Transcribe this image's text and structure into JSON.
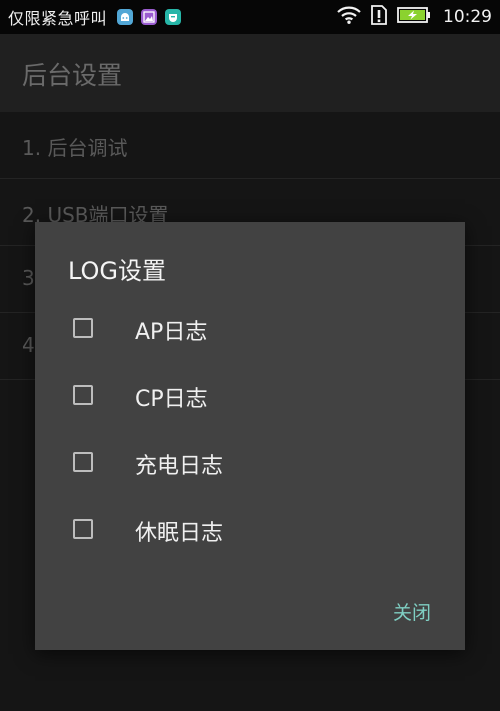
{
  "status_bar": {
    "carrier_text": "仅限紧急呼叫",
    "time": "10:29",
    "app_icons": [
      "android-debug-icon",
      "gallery-icon",
      "notification-app-icon"
    ],
    "icons_right": [
      "wifi-icon",
      "sim-icon",
      "battery-charging-icon"
    ]
  },
  "app_bar": {
    "title": "后台设置"
  },
  "list": {
    "items": [
      {
        "label": "1. 后台调试"
      },
      {
        "label": "2. USB端口设置"
      },
      {
        "label": "3"
      },
      {
        "label": "4"
      }
    ]
  },
  "dialog": {
    "title": "LOG设置",
    "options": [
      {
        "label": "AP日志",
        "checked": false
      },
      {
        "label": "CP日志",
        "checked": false
      },
      {
        "label": "充电日志",
        "checked": false
      },
      {
        "label": "休眠日志",
        "checked": false
      }
    ],
    "close_label": "关闭"
  },
  "colors": {
    "accent": "#7fcfc3",
    "dialog_bg": "#424242",
    "battery_green": "#8bd22f"
  }
}
